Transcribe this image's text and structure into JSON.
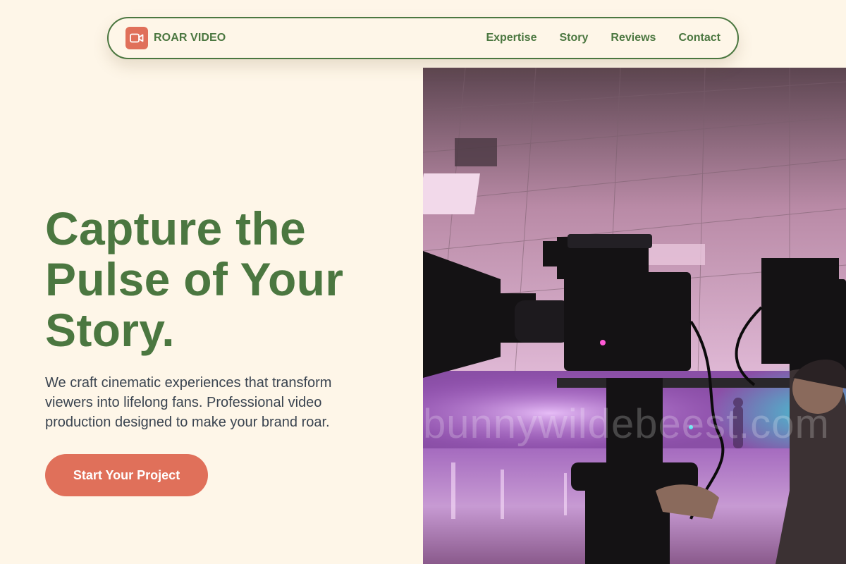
{
  "brand": {
    "name": "ROAR VIDEO",
    "logo_icon": "video-camera-icon",
    "accent": "#e0705a"
  },
  "nav": {
    "links": [
      "Expertise",
      "Story",
      "Reviews",
      "Contact"
    ]
  },
  "hero": {
    "title_lines": [
      "Capture the",
      "Pulse of Your",
      "Story."
    ],
    "subtitle": "We craft cinematic experiences that transform viewers into lifelong fans. Professional video production designed to make your brand roar.",
    "cta_label": "Start Your Project",
    "image_watermark": "bunnywildebeest.com"
  },
  "colors": {
    "background": "#fef6e8",
    "primary_green": "#4b7740",
    "text_body": "#3a4450",
    "cta": "#e0705a"
  }
}
